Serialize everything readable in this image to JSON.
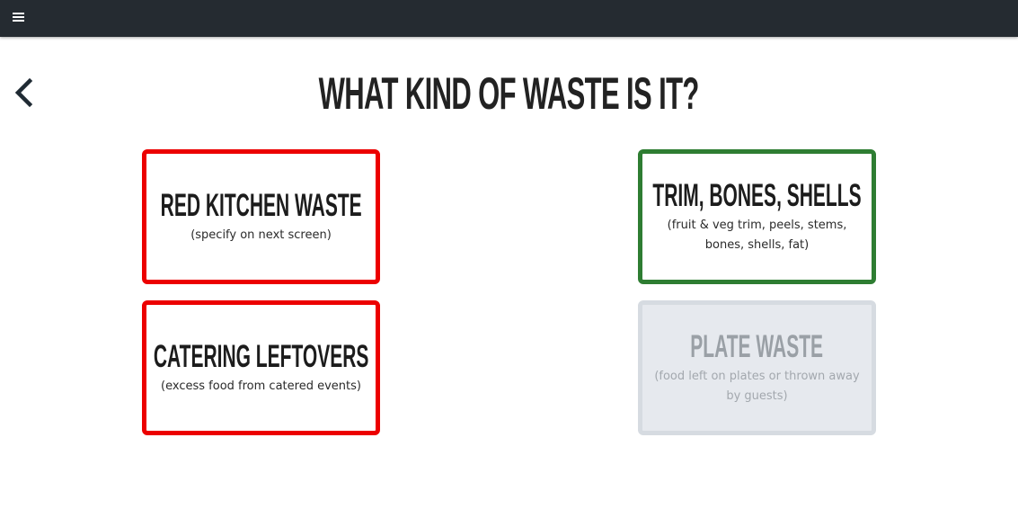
{
  "header": {
    "menu_icon": "hamburger-menu-icon"
  },
  "nav": {
    "back_icon": "chevron-left-icon"
  },
  "page": {
    "title": "WHAT KIND OF WASTE IS IT?"
  },
  "options": [
    {
      "title": "RED KITCHEN WASTE",
      "subtitle": "(specify on next screen)",
      "border_color": "#ec0000",
      "enabled": true
    },
    {
      "title": "TRIM, BONES, SHELLS",
      "subtitle": "(fruit & veg trim, peels, stems, bones, shells, fat)",
      "border_color": "#2e7d32",
      "enabled": true
    },
    {
      "title": "CATERING LEFTOVERS",
      "subtitle": "(excess food from catered events)",
      "border_color": "#ec0000",
      "enabled": true
    },
    {
      "title": "PLATE WASTE",
      "subtitle": "(food left on plates or thrown away by guests)",
      "border_color": "#d6dbe1",
      "enabled": false
    }
  ],
  "colors": {
    "topbar": "#252b31",
    "red": "#ec0000",
    "green": "#2e7d32",
    "disabled_bg": "#e6e9ee"
  }
}
